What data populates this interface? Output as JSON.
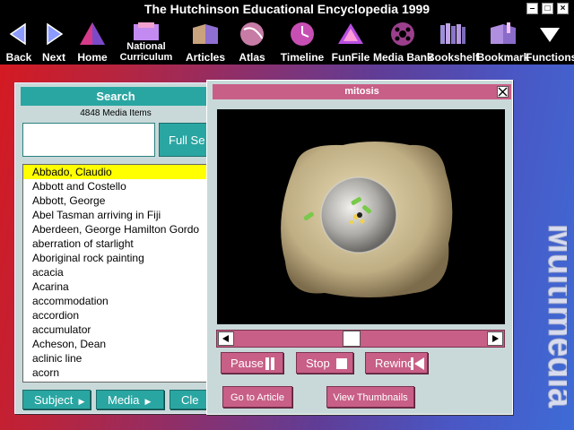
{
  "app": {
    "title": "The Hutchinson Educational Encyclopedia 1999"
  },
  "window_buttons": {
    "minimize": "–",
    "maximize": "□",
    "close": "×"
  },
  "toolbar": {
    "back": "Back",
    "next": "Next",
    "home": "Home",
    "national_curriculum_line1": "National",
    "national_curriculum_line2": "Curriculum",
    "articles": "Articles",
    "atlas": "Atlas",
    "timeline": "Timeline",
    "funfile": "FunFile",
    "mediabank": "Media Bank",
    "bookshelf": "Bookshelf",
    "bookmark": "Bookmark",
    "functions": "Functions"
  },
  "side_label": "Multimedia",
  "search": {
    "header": "Search",
    "count": "4848  Media Items",
    "query": "",
    "full_search_label": "Full Se",
    "results": [
      "Abbado, Claudio",
      "Abbott and Costello",
      "Abbott, George",
      "Abel Tasman arriving in Fiji",
      "Aberdeen, George Hamilton Gordo",
      "aberration of starlight",
      "Aboriginal rock painting",
      "acacia",
      "Acarina",
      "accommodation",
      "accordion",
      "accumulator",
      "Acheson, Dean",
      "aclinic line",
      "acorn"
    ],
    "selected": "Abbado, Claudio",
    "subject_label": "Subject",
    "media_label": "Media",
    "clear_label": "Cle"
  },
  "player": {
    "title": "mitosis",
    "progress": 0.46,
    "pause_label": "Pause",
    "stop_label": "Stop",
    "rewind_label": "Rewind",
    "go_article_label": "Go to Article",
    "thumbnails_label": "View Thumbnails"
  },
  "colors": {
    "teal": "#2aa6a2",
    "pink": "#c85f86",
    "panel": "#c9d9d9",
    "selection": "#ffff00"
  }
}
